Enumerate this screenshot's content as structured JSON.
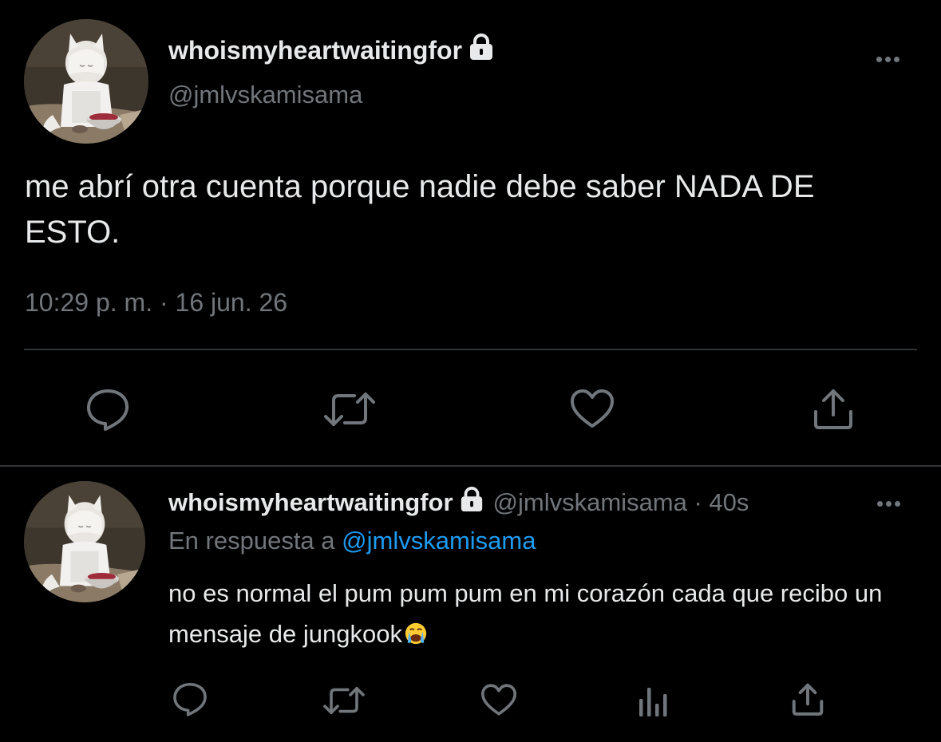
{
  "main_tweet": {
    "display_name": "whoismyheartwaitingfor",
    "handle": "@jmlvskamisama",
    "text": "me abrí otra cuenta porque nadie debe saber NADA DE ESTO.",
    "timestamp": "10:29 p. m. · 16 jun. 26",
    "avatar_icon": "anime-avatar",
    "protected_icon": "lock-icon",
    "actions": [
      "reply-icon",
      "retweet-icon",
      "like-icon",
      "share-icon"
    ]
  },
  "reply_tweet": {
    "display_name": "whoismyheartwaitingfor",
    "meta": "@jmlvskamisama · 40s",
    "reply_prefix": "En respuesta a",
    "reply_mention": "@jmlvskamisama",
    "text": "no es normal el pum pum pum en mi corazón cada que recibo un mensaje de jungkook",
    "emoji": "crying-face-emoji",
    "actions": [
      "reply-icon",
      "retweet-icon",
      "like-icon",
      "analytics-icon",
      "share-icon"
    ]
  },
  "colors": {
    "background": "#000000",
    "primary_text": "#e7e9ea",
    "secondary_text": "#71767b",
    "link": "#1d9bf0",
    "divider": "#2f3336"
  }
}
